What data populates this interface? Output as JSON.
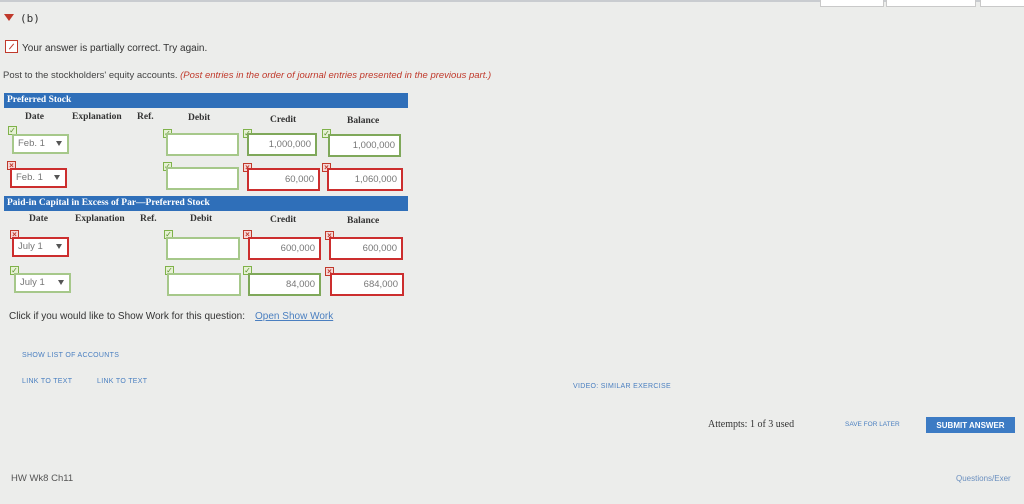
{
  "part": {
    "label": "(b)"
  },
  "feedback": {
    "text": "Your answer is partially correct.  Try again."
  },
  "instructions": {
    "main": "Post to the stockholders' equity accounts.",
    "note": "(Post entries in the order of journal entries presented in the previous part.)"
  },
  "columns": {
    "date": "Date",
    "explanation": "Explanation",
    "ref": "Ref.",
    "debit": "Debit",
    "credit": "Credit",
    "balance": "Balance"
  },
  "accounts": [
    {
      "title": "Preferred Stock",
      "rows": [
        {
          "date": "Feb. 1",
          "debit": "",
          "credit": "1,000,000",
          "balance": "1,000,000"
        },
        {
          "date": "Feb. 1",
          "debit": "",
          "credit": "60,000",
          "balance": "1,060,000"
        }
      ]
    },
    {
      "title": "Paid-in Capital in Excess of Par—Preferred Stock",
      "rows": [
        {
          "date": "July 1",
          "debit": "",
          "credit": "600,000",
          "balance": "600,000"
        },
        {
          "date": "July 1",
          "debit": "",
          "credit": "84,000",
          "balance": "684,000"
        }
      ]
    }
  ],
  "show_work": {
    "prompt": "Click if you would like to Show Work for this question:",
    "link": "Open Show Work"
  },
  "links": {
    "show_accounts": "SHOW LIST OF ACCOUNTS",
    "link_text_1": "LINK TO TEXT",
    "link_text_2": "LINK TO TEXT",
    "video": "VIDEO: SIMILAR EXERCISE"
  },
  "attempts": "Attempts: 1 of 3 used",
  "save_later": "SAVE FOR LATER",
  "submit": "SUBMIT ANSWER",
  "footer": {
    "left": "HW Wk8 Ch11",
    "right": "Questions/Exer"
  },
  "colors": {
    "accent": "#2f6fb9",
    "error": "#cc2e2e",
    "correct": "#7fb24a"
  }
}
